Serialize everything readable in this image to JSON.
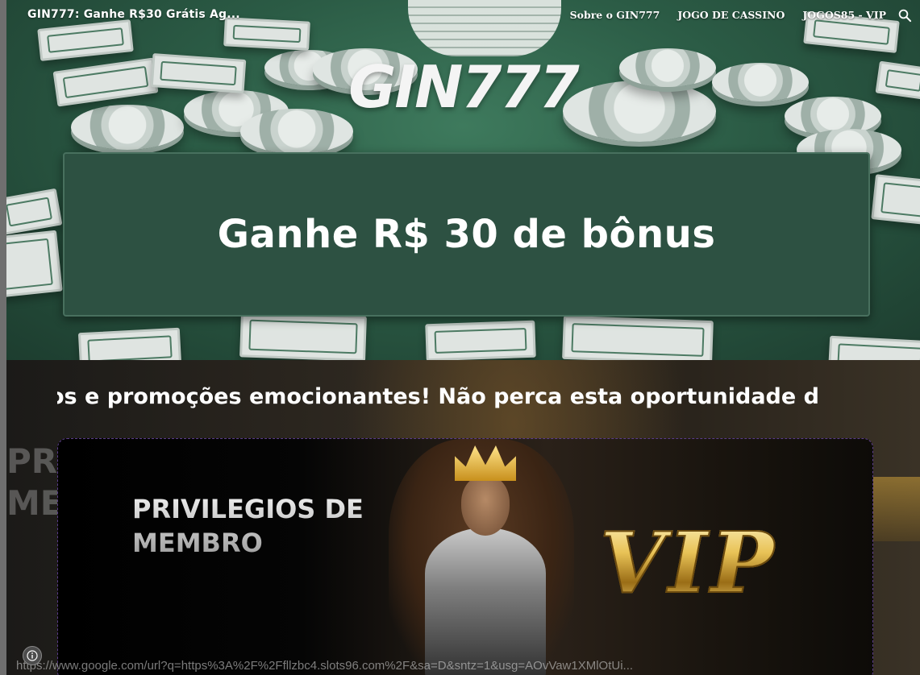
{
  "header": {
    "site_title": "GIN777: Ganhe R$30 Grátis Ag...",
    "nav": [
      "Sobre o GIN777",
      "JOGO DE CASSINO",
      "JOGOS85 - VIP"
    ],
    "search_icon": "search-icon"
  },
  "hero": {
    "logo_text": "GIN777",
    "banner_title": "Ganhe R$ 30 de bônus"
  },
  "promo": {
    "marquee_text": "os e promoções emocionantes! Não perca esta oportunidade d",
    "ghost_text_line1": "PRI",
    "ghost_text_line2": "ME"
  },
  "vip_banner": {
    "heading_line1": "PRIVILEGIOS DE",
    "heading_line2": "MEMBRO",
    "badge": "VIP"
  },
  "status_bar": {
    "url": "https://www.google.com/url?q=https%3A%2F%2Ffllzbc4.slots96.com%2F&sa=D&sntz=1&usg=AOvVaw1XMlOtUi..."
  },
  "colors": {
    "banner_bg": "#2d5142",
    "hero_green": "#2b5b45"
  }
}
